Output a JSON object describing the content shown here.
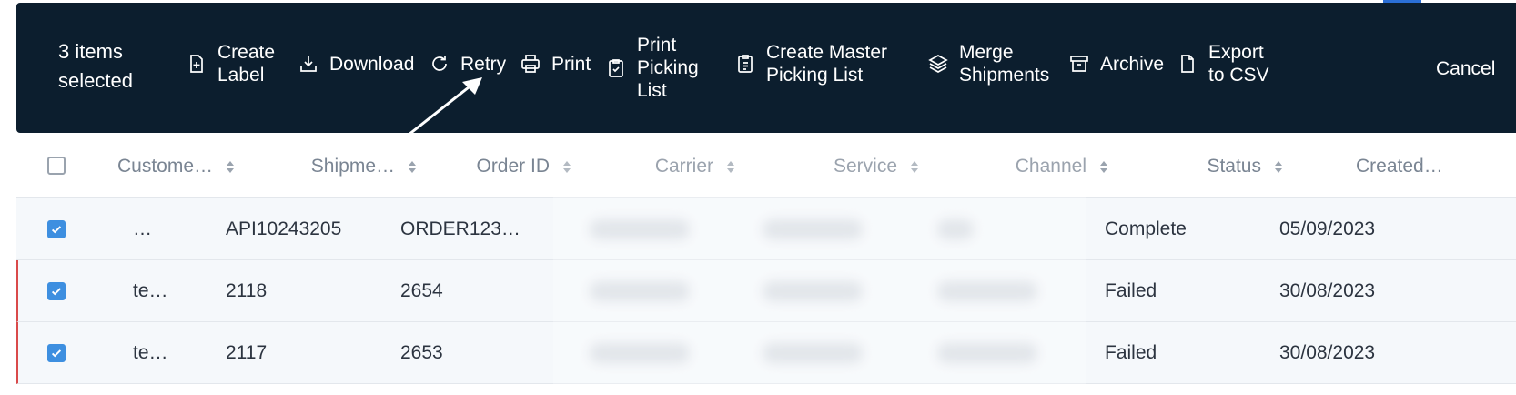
{
  "toolbar": {
    "selected_count": "3 items selected",
    "actions": [
      {
        "label": "Create Label",
        "icon": "file-plus-icon"
      },
      {
        "label": "Download",
        "icon": "download-icon"
      },
      {
        "label": "Retry",
        "icon": "retry-icon"
      },
      {
        "label": "Print",
        "icon": "printer-icon"
      },
      {
        "label": "Print Picking List",
        "icon": "clipboard-check-icon"
      },
      {
        "label": "Create Master Picking List",
        "icon": "clipboard-list-icon"
      },
      {
        "label": "Merge Shipments",
        "icon": "layers-icon"
      },
      {
        "label": "Archive",
        "icon": "archive-icon"
      },
      {
        "label": "Export to CSV",
        "icon": "file-icon"
      }
    ],
    "cancel_label": "Cancel"
  },
  "table": {
    "columns": [
      "Custome…",
      "Shipme…",
      "Order ID",
      "Carrier",
      "Service",
      "Channel",
      "Status",
      "Created…"
    ],
    "rows": [
      {
        "customer": "…",
        "shipment": "API10243205",
        "order_id": "ORDER123…",
        "carrier": "",
        "service": "",
        "channel": "",
        "status": "Complete",
        "created": "05/09/2023",
        "checked": true
      },
      {
        "customer": "te…",
        "shipment": "2118",
        "order_id": "2654",
        "carrier": "",
        "service": "",
        "channel": "",
        "status": "Failed",
        "created": "30/08/2023",
        "checked": true
      },
      {
        "customer": "te…",
        "shipment": "2117",
        "order_id": "2653",
        "carrier": "",
        "service": "",
        "channel": "",
        "status": "Failed",
        "created": "30/08/2023",
        "checked": true
      }
    ]
  },
  "colors": {
    "toolbar_bg": "#0c1e2e",
    "checkbox_checked": "#3d8fe0",
    "failed_marker": "#d94a4a",
    "header_text": "#7a8593"
  }
}
